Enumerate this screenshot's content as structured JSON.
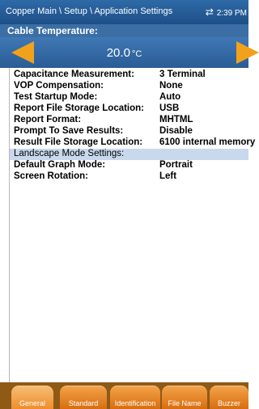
{
  "titlebar": {
    "breadcrumb": "Copper Main \\ Setup \\ Application Settings",
    "arrows": "⇄",
    "time": "2:39 PM"
  },
  "section_header": "Cable Temperature:",
  "temperature": {
    "value": "20.0",
    "unit": "°C"
  },
  "settings": [
    {
      "label": "Capacitance Measurement:",
      "value": "3 Terminal"
    },
    {
      "label": "VOP Compensation:",
      "value": "None"
    },
    {
      "label": "Test Startup Mode:",
      "value": "Auto"
    },
    {
      "label": "Report File Storage Location:",
      "value": "USB"
    },
    {
      "label": "Report Format:",
      "value": "MHTML"
    },
    {
      "label": "Prompt To Save Results:",
      "value": "Disable"
    },
    {
      "label": "Result File Storage Location:",
      "value": "6100 internal memory"
    },
    {
      "label": "Landscape Mode Settings:",
      "value": ""
    },
    {
      "label": "Default Graph Mode:",
      "value": "Portrait"
    },
    {
      "label": "Screen Rotation:",
      "value": "Left"
    }
  ],
  "tabs": [
    {
      "label": "General",
      "active": true
    },
    {
      "label": "Standard",
      "active": false
    },
    {
      "label": "Identification",
      "active": false
    },
    {
      "label": "File Name",
      "active": false
    },
    {
      "label": "Buzzer",
      "active": false
    }
  ],
  "colors": {
    "accent": "#f2a21a",
    "header_blue": "#2e6aa8",
    "selection": "#c8d9ee",
    "tab_orange": "#ef8d2d"
  }
}
